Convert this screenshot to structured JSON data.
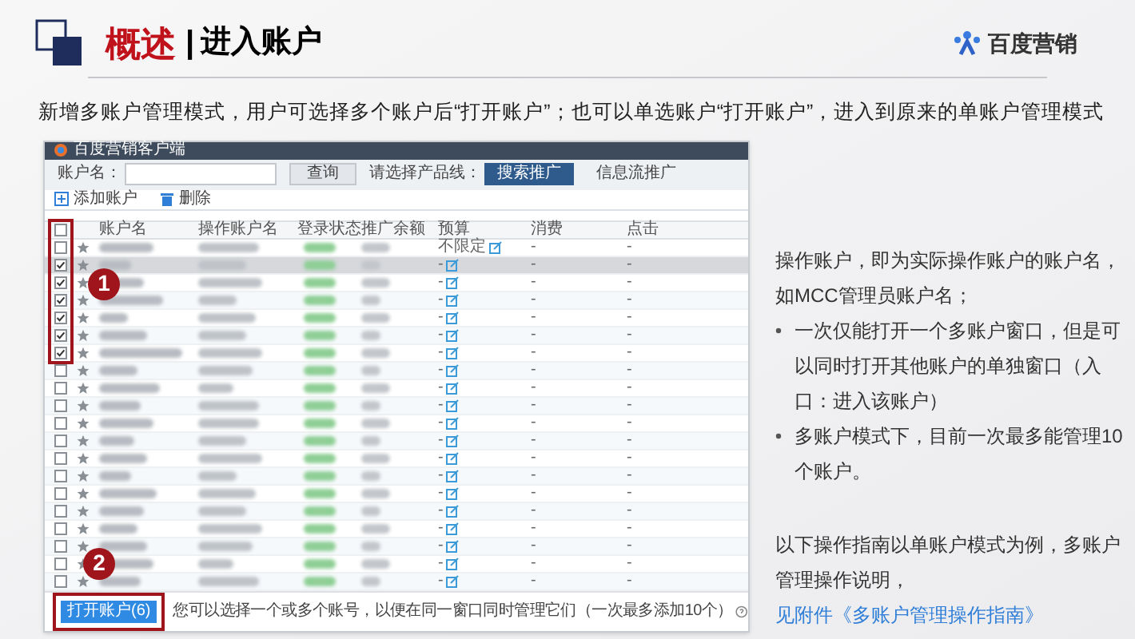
{
  "slide": {
    "title": "概述",
    "subtitle_title": "进入账户",
    "separator": "|",
    "logo": "百度营销",
    "intro": "新增多账户管理模式，用户可选择多个账户后“打开账户”；也可以单选账户“打开账户”，进入到原来的单账户管理模式"
  },
  "app": {
    "window_title": "百度营销客户端",
    "search_label": "账户名：",
    "search_button": "查询",
    "product_label": "请选择产品线：",
    "product_tabs": [
      {
        "label": "搜索推广",
        "selected": true
      },
      {
        "label": "信息流推广",
        "selected": false
      }
    ],
    "actions": [
      {
        "kind": "add",
        "label": "添加账户"
      },
      {
        "kind": "delete",
        "label": "删除"
      }
    ],
    "table": {
      "select_all_checked": false,
      "columns": [
        "账户名",
        "操作账户名",
        "登录状态",
        "推广余额",
        "预算",
        "消费",
        "点击"
      ],
      "rows": [
        {
          "checked": false,
          "highlighted": false,
          "budget": "不限定",
          "spend": "-",
          "clicks": "-"
        },
        {
          "checked": true,
          "highlighted": true,
          "budget": "-",
          "spend": "-",
          "clicks": "-"
        },
        {
          "checked": true,
          "highlighted": false,
          "budget": "-",
          "spend": "-",
          "clicks": "-"
        },
        {
          "checked": true,
          "highlighted": false,
          "budget": "-",
          "spend": "-",
          "clicks": "-"
        },
        {
          "checked": true,
          "highlighted": false,
          "budget": "-",
          "spend": "-",
          "clicks": "-"
        },
        {
          "checked": true,
          "highlighted": false,
          "budget": "-",
          "spend": "-",
          "clicks": "-"
        },
        {
          "checked": true,
          "highlighted": false,
          "budget": "-",
          "spend": "-",
          "clicks": "-"
        },
        {
          "checked": false,
          "highlighted": false,
          "budget": "-",
          "spend": "-",
          "clicks": "-"
        },
        {
          "checked": false,
          "highlighted": false,
          "budget": "-",
          "spend": "-",
          "clicks": "-"
        },
        {
          "checked": false,
          "highlighted": false,
          "budget": "-",
          "spend": "-",
          "clicks": "-"
        },
        {
          "checked": false,
          "highlighted": false,
          "budget": "-",
          "spend": "-",
          "clicks": "-"
        },
        {
          "checked": false,
          "highlighted": false,
          "budget": "-",
          "spend": "-",
          "clicks": "-"
        },
        {
          "checked": false,
          "highlighted": false,
          "budget": "-",
          "spend": "-",
          "clicks": "-"
        },
        {
          "checked": false,
          "highlighted": false,
          "budget": "-",
          "spend": "-",
          "clicks": "-"
        },
        {
          "checked": false,
          "highlighted": false,
          "budget": "-",
          "spend": "-",
          "clicks": "-"
        },
        {
          "checked": false,
          "highlighted": false,
          "budget": "-",
          "spend": "-",
          "clicks": "-"
        },
        {
          "checked": false,
          "highlighted": false,
          "budget": "-",
          "spend": "-",
          "clicks": "-"
        },
        {
          "checked": false,
          "highlighted": false,
          "budget": "-",
          "spend": "-",
          "clicks": "-"
        },
        {
          "checked": false,
          "highlighted": false,
          "budget": "-",
          "spend": "-",
          "clicks": "-"
        },
        {
          "checked": false,
          "highlighted": false,
          "budget": "-",
          "spend": "-",
          "clicks": "-"
        }
      ]
    },
    "open_button": "打开账户(6)",
    "footer_hint": "您可以选择一个或多个账号，以便在同一窗口同时管理它们（一次最多添加10个）",
    "callouts": [
      "1",
      "2"
    ]
  },
  "notes": {
    "paragraph": "操作账户，即为实际操作账户的账户名，如MCC管理员账户名；",
    "bullets": [
      "一次仅能打开一个多账户窗口，但是可以同时打开其他账户的单独窗口（入口：进入该账户）",
      "多账户模式下，目前一次最多能管理10个账户。"
    ],
    "closing": "以下操作指南以单账户模式为例，多账户管理操作说明，",
    "closing_link": "见附件《多账户管理操作指南》"
  }
}
